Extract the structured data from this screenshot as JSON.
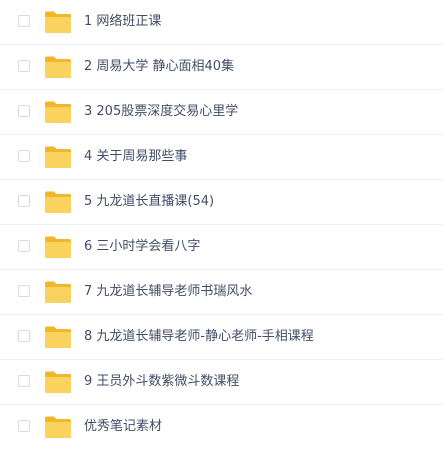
{
  "files": [
    {
      "name": "1 网络班正课",
      "icon": "folder-icon"
    },
    {
      "name": "2 周易大学 静心面相40集",
      "icon": "folder-icon"
    },
    {
      "name": "3 205股票深度交易心里学",
      "icon": "folder-icon"
    },
    {
      "name": "4 关于周易那些事",
      "icon": "folder-icon"
    },
    {
      "name": "5 九龙道长直播课(54)",
      "icon": "folder-icon"
    },
    {
      "name": "6 三小时学会看八字",
      "icon": "folder-icon"
    },
    {
      "name": "7 九龙道长辅导老师书瑞风水",
      "icon": "folder-icon"
    },
    {
      "name": "8 九龙道长辅导老师-静心老师-手相课程",
      "icon": "folder-icon"
    },
    {
      "name": "9 王员外斗数紫微斗数课程",
      "icon": "folder-icon"
    },
    {
      "name": "优秀笔记素材",
      "icon": "folder-icon"
    }
  ],
  "colors": {
    "folder_back": "#f2b62a",
    "folder_front": "#fad35e",
    "text": "#424e67",
    "divider": "#eef0f4",
    "checkbox_border": "#d7dbe2"
  }
}
